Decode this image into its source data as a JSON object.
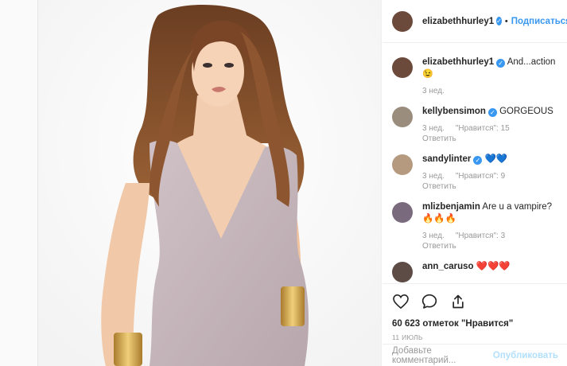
{
  "post": {
    "username": "elizabethhurley1",
    "follow_label": "Подписаться",
    "caption": "And...action",
    "caption_emoji": "😉",
    "caption_time": "3 нед."
  },
  "comments": [
    {
      "username": "kellybensimon",
      "verified": true,
      "text": "GORGEOUS",
      "time": "3 нед.",
      "likes": "\"Нравится\": 15",
      "reply": "Ответить",
      "avatar_color": "#9a8d7e"
    },
    {
      "username": "sandylinter",
      "verified": true,
      "text": "💙💙",
      "time": "3 нед.",
      "likes": "\"Нравится\": 9",
      "reply": "Ответить",
      "avatar_color": "#b59a80"
    },
    {
      "username": "mlizbenjamin",
      "verified": false,
      "text": "Are u a vampire? 🔥🔥🔥",
      "time": "3 нед.",
      "likes": "\"Нравится\": 3",
      "reply": "Ответить",
      "avatar_color": "#7a6a7e"
    },
    {
      "username": "ann_caruso",
      "verified": false,
      "text": "❤️❤️❤️",
      "time": "",
      "likes": "",
      "reply": "",
      "avatar_color": "#5d4c45"
    }
  ],
  "likes_count": "60 623 отметок \"Нравится\"",
  "date": "11 ИЮЛЬ",
  "add_comment_placeholder": "Добавьте комментарий...",
  "post_button": "Опубликовать",
  "icons": [
    "heart-icon",
    "comment-icon",
    "share-icon"
  ],
  "colors": {
    "link": "#3897f0",
    "verified": "#3897f0",
    "muted": "#999999",
    "dress": "#c7b7bd"
  }
}
